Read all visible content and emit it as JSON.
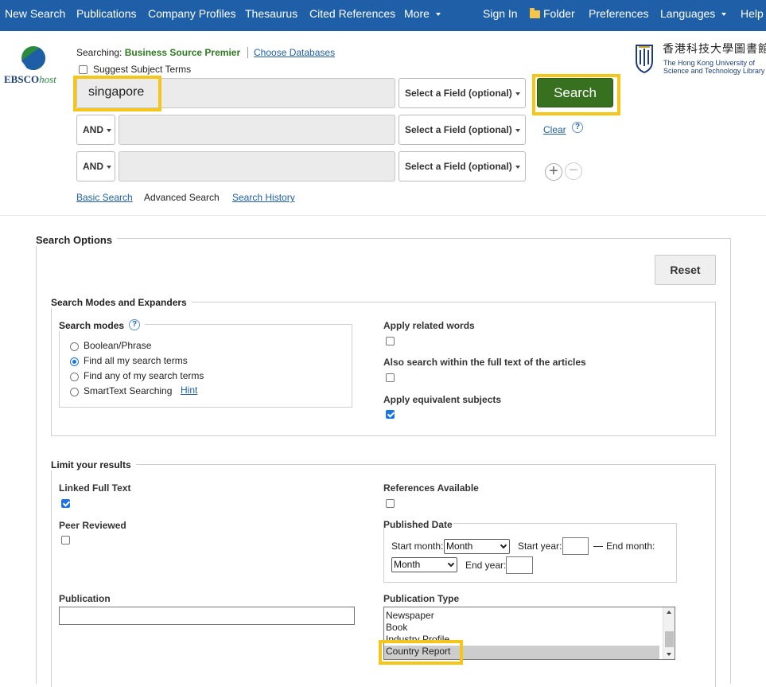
{
  "topnav": {
    "left": [
      "New Search",
      "Publications",
      "Company Profiles",
      "Thesaurus",
      "Cited References",
      "More"
    ],
    "right": [
      "Sign In",
      "Folder",
      "Preferences",
      "Languages",
      "Help"
    ]
  },
  "brand": {
    "name_bold": "EBSCO",
    "name_italic": "host"
  },
  "library": {
    "chinese": "香港科技大學圖書館",
    "line1": "The Hong Kong University of",
    "line2": "Science and Technology Library"
  },
  "searching": {
    "label": "Searching:",
    "database": "Business Source Premier",
    "choose": "Choose Databases"
  },
  "suggest_label": "Suggest Subject Terms",
  "rows": [
    {
      "query": "singapore",
      "field": "Select a Field (optional)"
    },
    {
      "operator": "AND",
      "query": "",
      "field": "Select a Field (optional)"
    },
    {
      "operator": "AND",
      "query": "",
      "field": "Select a Field (optional)"
    }
  ],
  "search_button": "Search",
  "clear_link": "Clear",
  "help_glyph": "?",
  "plus_glyph": "+",
  "minus_glyph": "−",
  "subnav": {
    "basic": "Basic Search",
    "advanced": "Advanced Search",
    "history": "Search History"
  },
  "options": {
    "title": "Search Options",
    "reset": "Reset",
    "modes_title": "Search Modes and Expanders",
    "search_modes_label": "Search modes",
    "modes": [
      "Boolean/Phrase",
      "Find all my search terms",
      "Find any of my search terms",
      "SmartText Searching"
    ],
    "selected_mode": 1,
    "hint": "Hint",
    "related_words": "Apply related words",
    "full_text_search": "Also search within the full text of the articles",
    "equivalent_subjects": "Apply equivalent subjects",
    "limit_title": "Limit your results",
    "linked_full_text": "Linked Full Text",
    "references_available": "References Available",
    "peer_reviewed": "Peer Reviewed",
    "published_date": "Published Date",
    "start_month_label": "Start month:",
    "start_month_value": "Month",
    "start_year_label": "Start year:",
    "end_month_label": "End month:",
    "end_month_value": "Month",
    "end_year_label": "End year:",
    "publication_label": "Publication",
    "publication_type_label": "Publication Type",
    "publication_types": [
      "Newspaper",
      "Book",
      "Industry Profile",
      "Country Report"
    ],
    "selected_publication_type": "Country Report"
  },
  "checks": {
    "suggest": false,
    "related_words": false,
    "full_text": false,
    "equivalent_subjects": true,
    "linked_full_text": true,
    "references_available": false,
    "peer_reviewed": false
  },
  "colors": {
    "nav_bg": "#1e5fa8",
    "search_btn": "#37701f",
    "highlight": "#f5c518",
    "db_name": "#2e7a20"
  }
}
